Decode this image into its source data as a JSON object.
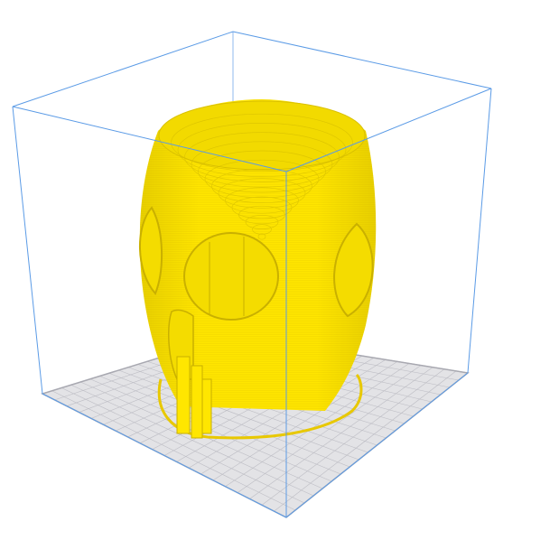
{
  "scene": {
    "type": "3d-print-preview",
    "model_color": "#FFE600",
    "model_shade_color": "#D9C200",
    "build_volume_color": "#5B9BE6",
    "build_plate_color": "#E3E3E6",
    "build_plate_grid_color": "#B9B9C0",
    "background_color": "#FFFFFF",
    "icons": [
      "build-volume-wireframe",
      "build-plate",
      "printed-vase-model"
    ]
  }
}
